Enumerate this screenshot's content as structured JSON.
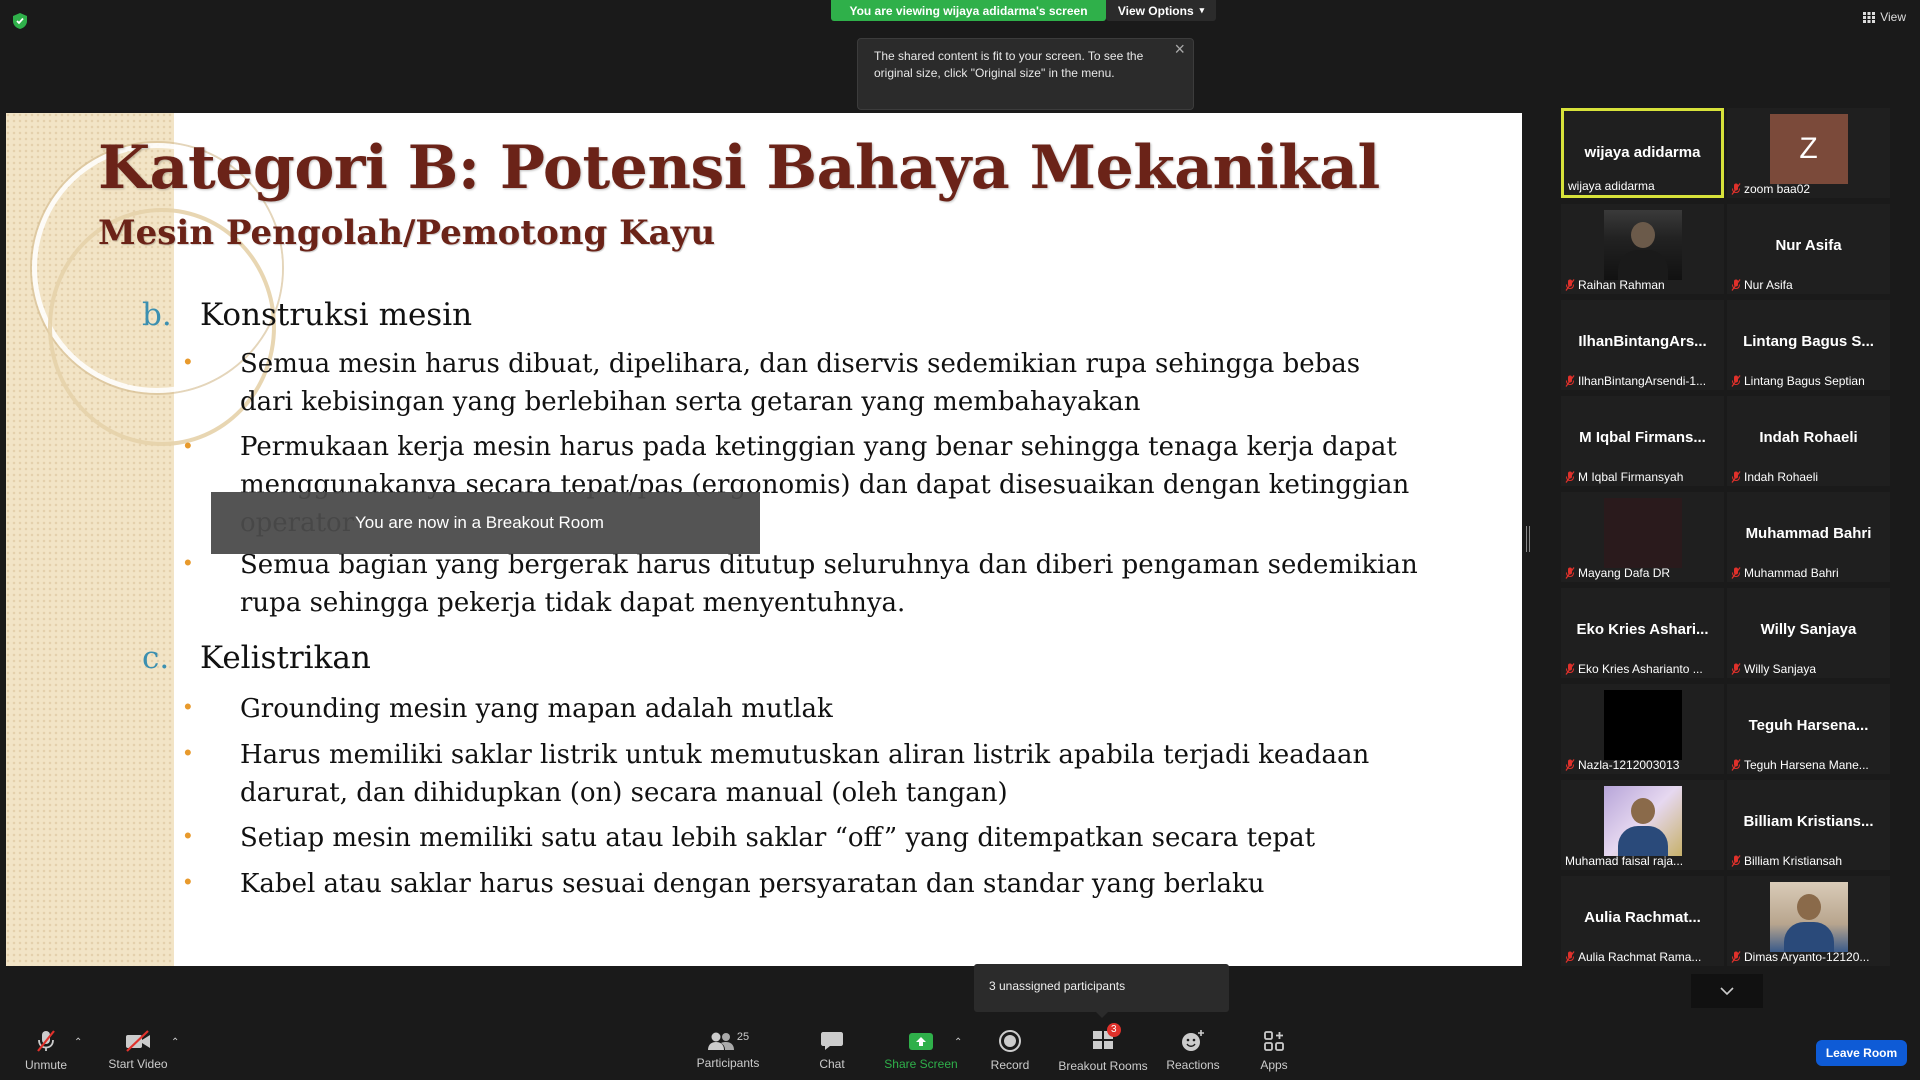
{
  "top": {
    "viewing_banner": "You are viewing wijaya adidarma's screen",
    "view_options": "View Options",
    "view_label": "View",
    "tooltip": "The shared content is fit to your screen. To see the original size, click \"Original size\" in the menu."
  },
  "slide": {
    "title": "Kategori B: Potensi Bahaya Mekanikal",
    "subtitle": "Mesin Pengolah/Pemotong Kayu",
    "sections": [
      {
        "letter": "b.",
        "heading": "Konstruksi mesin",
        "bullets": [
          "Semua mesin harus dibuat, dipelihara, dan diservis sedemikian rupa sehingga bebas dari kebisingan yang berlebihan serta getaran yang membahayakan",
          "Permukaan kerja mesin harus pada ketinggian yang benar sehingga tenaga kerja dapat menggunakanya secara tepat/pas (ergonomis) dan dapat disesuaikan dengan ketinggian operator",
          "Semua bagian yang bergerak harus ditutup seluruhnya dan diberi pengaman sedemikian rupa sehingga pekerja tidak dapat menyentuhnya."
        ]
      },
      {
        "letter": "c.",
        "heading": "Kelistrikan",
        "bullets": [
          "Grounding mesin yang mapan adalah mutlak",
          "Harus memiliki saklar listrik untuk memutuskan aliran listrik apabila terjadi keadaan darurat, dan dihidupkan (on) secara manual (oleh tangan)",
          "Setiap mesin memiliki satu atau lebih saklar “off” yang ditempatkan secara tepat",
          "Kabel atau saklar harus sesuai dengan persyaratan dan standar yang berlaku"
        ]
      }
    ]
  },
  "toast": "You are now in a Breakout Room",
  "participants_tiles": [
    {
      "display": "wijaya adidarma",
      "label": "wijaya adidarma",
      "muted": false,
      "active": true,
      "avatar": "none"
    },
    {
      "display": "Z",
      "label": "zoom baa02",
      "muted": true,
      "active": false,
      "avatar": "letter"
    },
    {
      "display": "",
      "label": "Raihan Rahman",
      "muted": true,
      "active": false,
      "avatar": "video-person"
    },
    {
      "display": "Nur Asifa",
      "label": "Nur Asifa",
      "muted": true,
      "active": false,
      "avatar": "none"
    },
    {
      "display": "IlhanBintangArs...",
      "label": "IlhanBintangArsendi-1...",
      "muted": true,
      "active": false,
      "avatar": "none"
    },
    {
      "display": "Lintang Bagus S...",
      "label": "Lintang Bagus Septian",
      "muted": true,
      "active": false,
      "avatar": "none"
    },
    {
      "display": "M Iqbal Firmans...",
      "label": "M Iqbal Firmansyah",
      "muted": true,
      "active": false,
      "avatar": "none"
    },
    {
      "display": "Indah Rohaeli",
      "label": "Indah Rohaeli",
      "muted": true,
      "active": false,
      "avatar": "none"
    },
    {
      "display": "",
      "label": "Mayang Dafa DR",
      "muted": true,
      "active": false,
      "avatar": "dark-video"
    },
    {
      "display": "Muhammad Bahri",
      "label": "Muhammad Bahri",
      "muted": true,
      "active": false,
      "avatar": "none"
    },
    {
      "display": "Eko Kries Ashari...",
      "label": "Eko Kries Asharianto ...",
      "muted": true,
      "active": false,
      "avatar": "none"
    },
    {
      "display": "Willy Sanjaya",
      "label": "Willy Sanjaya",
      "muted": true,
      "active": false,
      "avatar": "none"
    },
    {
      "display": "",
      "label": "Nazla-1212003013",
      "muted": true,
      "active": false,
      "avatar": "black-video"
    },
    {
      "display": "Teguh Harsena...",
      "label": "Teguh Harsena Mane...",
      "muted": true,
      "active": false,
      "avatar": "none"
    },
    {
      "display": "",
      "label": "Muhamad faisal raja...",
      "muted": false,
      "active": false,
      "avatar": "photo-sunglasses"
    },
    {
      "display": "Billiam Kristians...",
      "label": "Billiam Kristiansah",
      "muted": true,
      "active": false,
      "avatar": "none"
    },
    {
      "display": "Aulia Rachmat...",
      "label": "Aulia Rachmat Rama...",
      "muted": true,
      "active": false,
      "avatar": "none"
    },
    {
      "display": "",
      "label": "Dimas Aryanto-12120...",
      "muted": true,
      "active": false,
      "avatar": "photo-person"
    }
  ],
  "unassigned": "3 unassigned participants",
  "toolbar": {
    "unmute": "Unmute",
    "start_video": "Start Video",
    "participants": "Participants",
    "participants_count": "25",
    "chat": "Chat",
    "share_screen": "Share Screen",
    "record": "Record",
    "breakout_rooms": "Breakout Rooms",
    "breakout_badge": "3",
    "reactions": "Reactions",
    "apps": "Apps",
    "leave_room": "Leave Room"
  },
  "colors": {
    "banner_green": "#2fb04a",
    "active_speaker_border": "#d7e23a",
    "title_brown": "#6b2318",
    "section_letter_blue": "#3b8fb0",
    "bullet_orange": "#e89a2c",
    "leave_blue": "#0e5bd6",
    "share_green": "#2fb04a"
  }
}
